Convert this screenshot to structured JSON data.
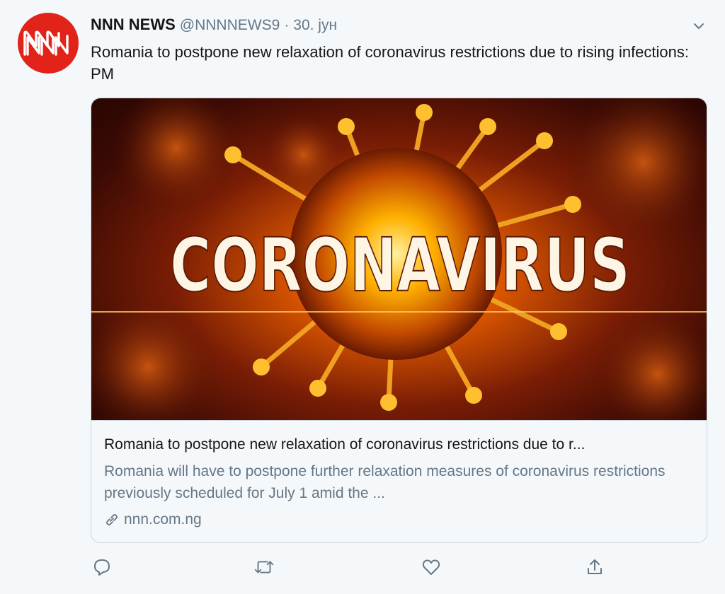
{
  "tweet": {
    "display_name": "NNN NEWS",
    "handle": "@NNNNEWS9",
    "separator": "·",
    "date": "30. јун",
    "text": "Romania to postpone new relaxation of coronavirus restrictions due to rising infections: PM"
  },
  "avatar": {
    "logo_text": "NNN",
    "color": "#e2231a"
  },
  "card": {
    "image_text": "CORONAVIRUS",
    "title": "Romania to postpone new relaxation of coronavirus restrictions due to r...",
    "description": "Romania will have to postpone further relaxation measures of coronavirus restrictions previously scheduled for July 1 amid the ...",
    "domain": "nnn.com.ng"
  },
  "actions": [
    {
      "name": "reply",
      "icon": "reply-icon"
    },
    {
      "name": "retweet",
      "icon": "retweet-icon"
    },
    {
      "name": "like",
      "icon": "heart-icon"
    },
    {
      "name": "share",
      "icon": "share-icon"
    }
  ],
  "colors": {
    "text_primary": "#14171a",
    "text_secondary": "#657786",
    "border": "#ccd6dd",
    "background": "#f5f8fa"
  }
}
